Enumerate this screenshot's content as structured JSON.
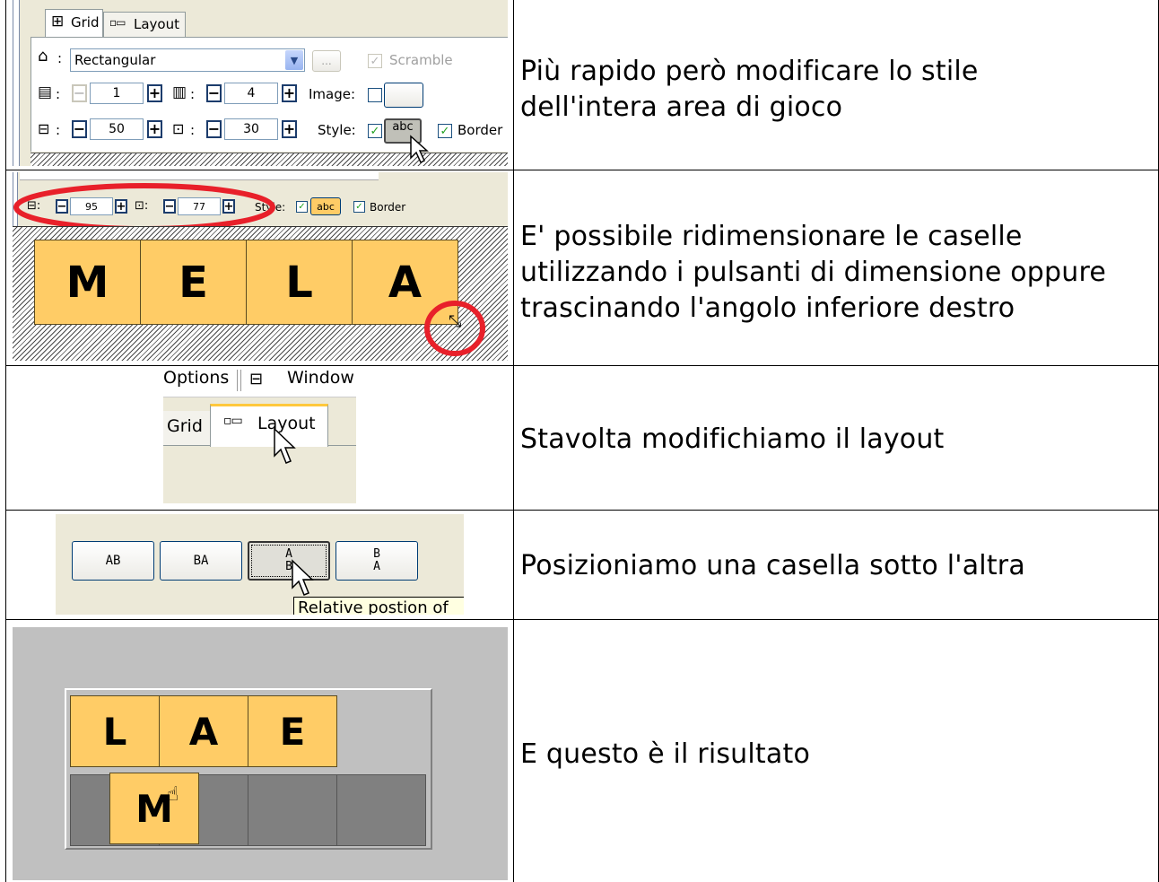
{
  "rows": [
    {
      "caption": "Più rapido però modificare lo stile dell'intera area di gioco"
    },
    {
      "caption": "E' possibile ridimensionare le caselle utilizzando i pulsanti di dimensione oppure trascinando l'angolo inferiore destro"
    },
    {
      "caption": "Stavolta modifichiamo il layout"
    },
    {
      "caption": "Posizioniamo una casella sotto l'altra"
    },
    {
      "caption": "E questo è il risultato"
    }
  ],
  "shot1": {
    "tab_grid": "Grid",
    "tab_layout": "Layout",
    "shape_value": "Rectangular",
    "ellipsis": "...",
    "scramble_label": "Scramble",
    "rows_value": "1",
    "cols_value": "4",
    "image_label": "Image:",
    "width_value": "50",
    "height_value": "30",
    "style_label": "Style:",
    "style_button": "abc",
    "border_label": "Border",
    "colon": ":"
  },
  "shot2": {
    "width_value": "95",
    "height_value": "77",
    "style_label": "Style:",
    "style_button": "abc",
    "border_label": "Border",
    "tiles": [
      "M",
      "E",
      "L",
      "A"
    ]
  },
  "shot3": {
    "menu_options": "Options",
    "menu_window": "Window",
    "tab_grid": "Grid",
    "tab_layout": "Layout"
  },
  "shot4": {
    "buttons": [
      "AB",
      "BA",
      "A\nB",
      "B\nA"
    ],
    "tooltip": "Relative postion of"
  },
  "shot5": {
    "top_tiles": [
      "L",
      "A",
      "E"
    ],
    "moving_tile": "M"
  },
  "colors": {
    "tile": "#ffcc66",
    "xp_panel": "#ece9d8",
    "selection_ring": "#e8202a"
  }
}
